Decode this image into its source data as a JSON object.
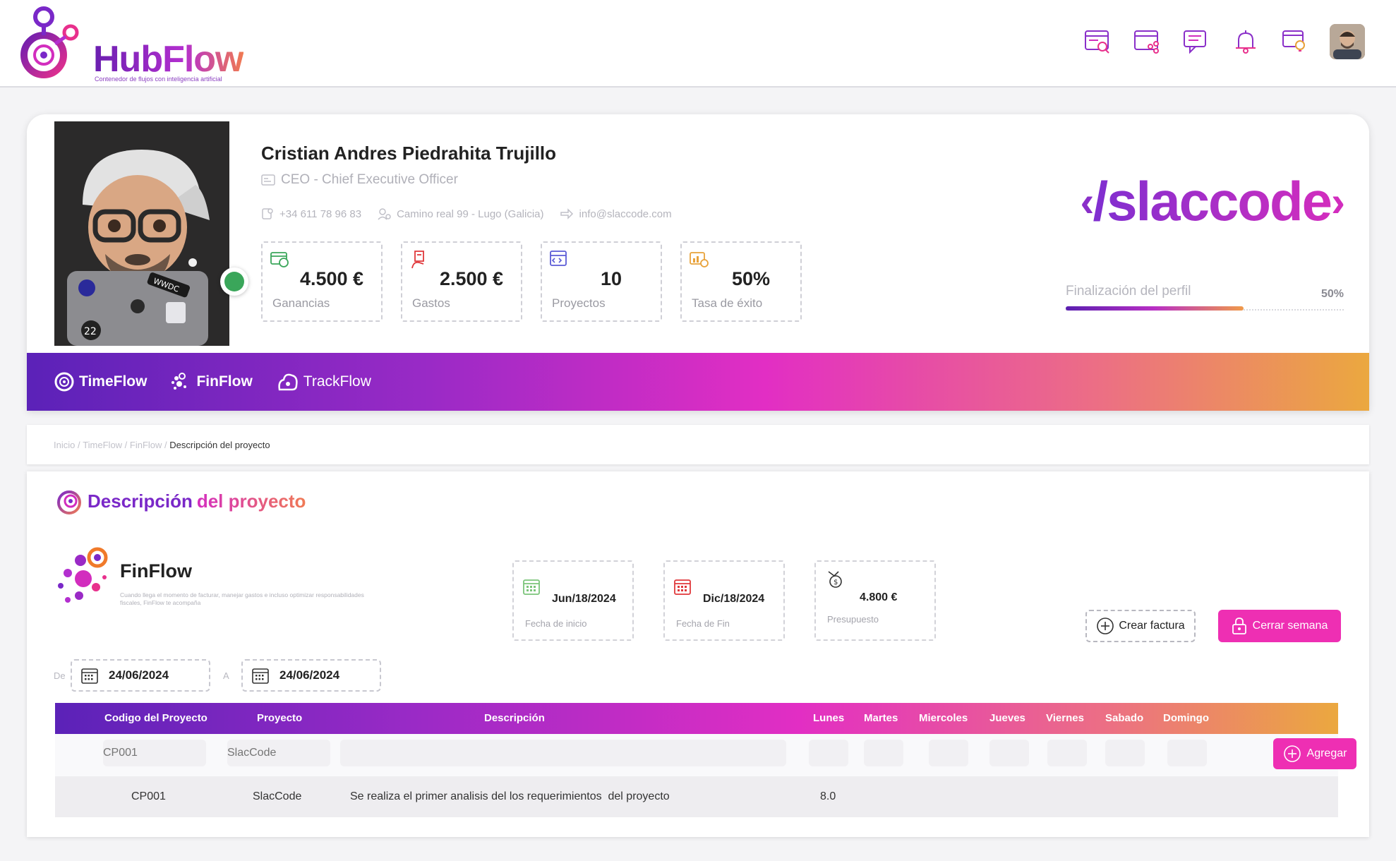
{
  "app": {
    "name": "HubFlow",
    "tagline": "Contenedor de flujos con inteligencia artificial"
  },
  "header": {
    "icons": [
      "web-search-icon",
      "web-share-icon",
      "chat-icon",
      "bell-icon",
      "lightbulb-icon"
    ]
  },
  "profile": {
    "name": "Cristian Andres Piedrahita Trujillo",
    "role": "CEO - Chief Executive Officer",
    "phone": "+34 611 78 96 83",
    "address": "Camino real 99 - Lugo (Galicia)",
    "email": "info@slaccode.com",
    "stats": [
      {
        "value": "4.500 €",
        "label": "Ganancias",
        "icon": "money-icon",
        "color": "#3aa65a"
      },
      {
        "value": "2.500 €",
        "label": "Gastos",
        "icon": "expense-icon",
        "color": "#e0383b"
      },
      {
        "value": "10",
        "label": "Proyectos",
        "icon": "code-window-icon",
        "color": "#5b5bd6"
      },
      {
        "value": "50%",
        "label": "Tasa de éxito",
        "icon": "chart-icon",
        "color": "#e8a23a"
      }
    ],
    "brand": "/slaccode",
    "completion_label": "Finalización del perfil",
    "completion_pct_text": "50%",
    "completion_fraction": 0.64
  },
  "apps": [
    {
      "name": "TimeFlow"
    },
    {
      "name": "FinFlow"
    },
    {
      "name": "TrackFlow"
    }
  ],
  "breadcrumb": {
    "items": [
      "Inicio",
      "TimeFlow",
      "FinFlow"
    ],
    "current": "Descripción del proyecto"
  },
  "section": {
    "title_a": "Descripción",
    "title_b": "del proyecto"
  },
  "project": {
    "name": "FinFlow",
    "description": "Cuando llega el momento de facturar, manejar gastos e incluso optimizar responsabilidades fiscales, FinFlow te acompaña",
    "start_date": "Jun/18/2024",
    "start_label": "Fecha de inicio",
    "end_date": "Dic/18/2024",
    "end_label": "Fecha de Fin",
    "budget": "4.800 €",
    "budget_label": "Presupuesto"
  },
  "actions": {
    "create_invoice": "Crear factura",
    "close_week": "Cerrar semana",
    "add": "Agregar"
  },
  "range": {
    "from_label": "De",
    "from": "24/06/2024",
    "to_label": "A",
    "to": "24/06/2024"
  },
  "table": {
    "headers": [
      "Codigo del Proyecto",
      "Proyecto",
      "Descripción",
      "Lunes",
      "Martes",
      "Miercoles",
      "Jueves",
      "Viernes",
      "Sabado",
      "Domingo"
    ],
    "input_row": {
      "code_placeholder": "CP001",
      "project_placeholder": "SlacCode"
    },
    "rows": [
      {
        "code": "CP001",
        "project": "SlacCode",
        "description": "Se realiza el primer analisis del los requerimientos  del proyecto",
        "lunes": "8.0"
      }
    ]
  }
}
